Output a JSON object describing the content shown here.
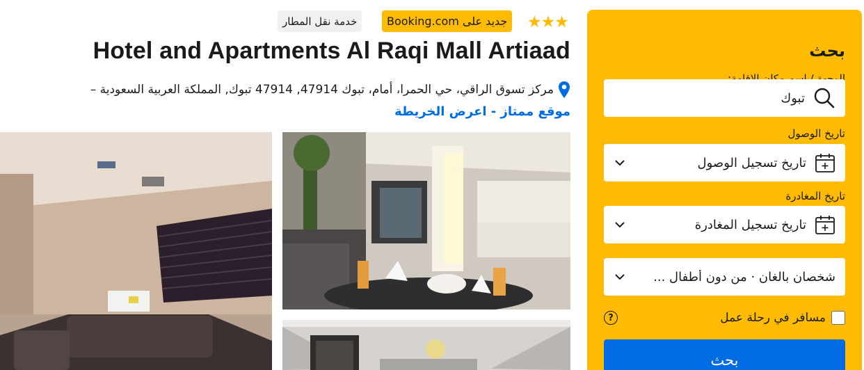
{
  "hotel": {
    "stars_count": 3,
    "stars_icon": "star-icon",
    "badge_new": "جديد على Booking.com",
    "badge_shuttle": "خدمة نقل المطار",
    "title": "Hotel and Apartments Al Raqi Mall Artiaad",
    "address": "مركز تسوق الراقي، حي الحمرا، أمام، تبوك 47914, 47914 تبوك, المملكة العربية السعودية –",
    "location_link": "موقع ممتاز - اعرض الخريطة"
  },
  "search": {
    "heading": "بحث",
    "destination_label": "الوجهة / اسم مكان الإقامة:",
    "destination_value": "تبوك",
    "checkin_label": "تاريخ الوصول",
    "checkin_value": "تاريخ تسجيل الوصول",
    "checkout_label": "تاريخ المغادرة",
    "checkout_value": "تاريخ تسجيل المغادرة",
    "guests_value": "شخصان بالغان · من دون أطفال ...",
    "business_label": "مسافر في رحلة عمل",
    "business_checked": false,
    "help_glyph": "?",
    "button_label": "بحث"
  },
  "colors": {
    "brand_yellow": "#febb02",
    "brand_blue": "#006ce4",
    "text_dark": "#1a1a1a"
  }
}
